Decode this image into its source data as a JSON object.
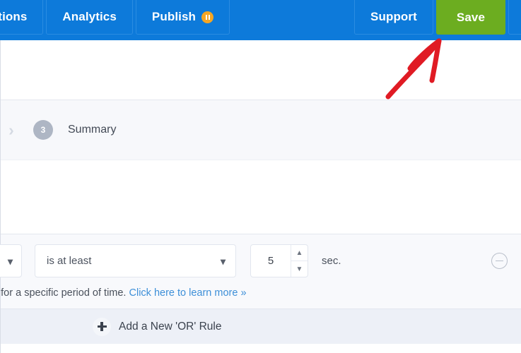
{
  "topnav": {
    "background_color": "#0d7ada",
    "items": [
      {
        "label": "egrations",
        "icon": null,
        "type": "nav"
      },
      {
        "label": "Analytics",
        "icon": null,
        "type": "nav"
      },
      {
        "label": "Publish",
        "icon": "pause-badge-icon",
        "type": "nav"
      }
    ],
    "right_items": [
      {
        "label": "Support",
        "icon": null,
        "type": "nav"
      },
      {
        "label": "Save",
        "icon": null,
        "type": "save",
        "color": "#6cad20"
      }
    ]
  },
  "step": {
    "chevron_icon": "chevron-right-icon",
    "number": "3",
    "label": "Summary"
  },
  "rule": {
    "operator_select_value": "",
    "condition_select_value": "is at least",
    "amount_value": "5",
    "unit_label": "sec.",
    "remove_icon": "minus-circle-icon",
    "hint_text": "ge for a specific period of time.",
    "hint_link": "Click here to learn more »"
  },
  "footer": {
    "add_icon": "plus-icon",
    "add_label": "Add a New 'OR' Rule"
  },
  "annotation": {
    "type": "arrow",
    "color": "#e01b24",
    "points_to": "Save"
  }
}
